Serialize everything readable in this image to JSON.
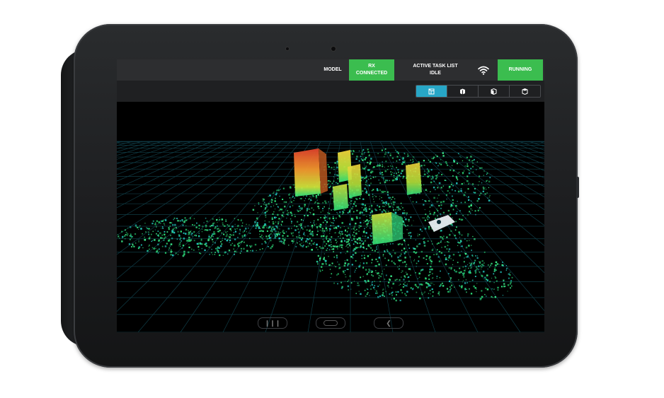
{
  "topbar": {
    "model_label": "MODEL",
    "rx_label": "RX",
    "rx_status": "CONNECTED",
    "task_label": "ACTIVE TASK LIST",
    "task_status": "IDLE",
    "run_status": "RUNNING"
  },
  "view_tabs": [
    {
      "icon": "perspective-view-icon",
      "active": true
    },
    {
      "icon": "front-view-icon",
      "active": false
    },
    {
      "icon": "side-view-icon",
      "active": false
    },
    {
      "icon": "top-view-icon",
      "active": false
    }
  ],
  "navbar": [
    "recent-apps-icon",
    "home-icon",
    "back-icon"
  ],
  "colors": {
    "status_green": "#3bbd4f",
    "active_tab": "#27a6c6",
    "pointcloud_green": "#2de07a",
    "pointcloud_cyan": "#22c7c0",
    "pointcloud_red": "#e0412b",
    "pointcloud_yellow": "#f2d23a"
  }
}
